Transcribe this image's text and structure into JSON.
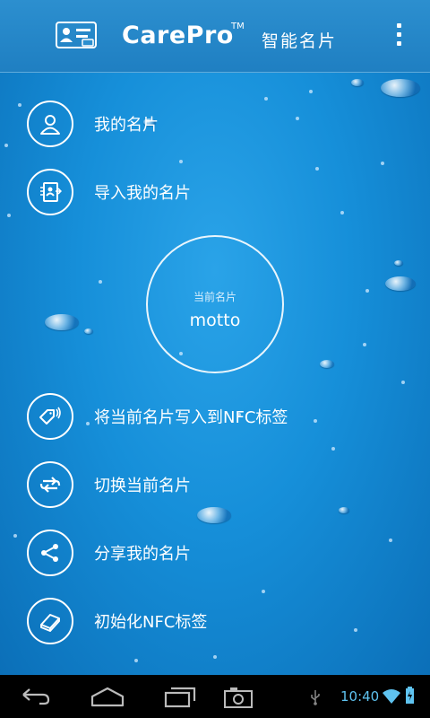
{
  "app": {
    "brand": "CarePro",
    "trademark": "TM",
    "title": "智能名片",
    "accent_color": "#1f7fc2"
  },
  "menu": {
    "items": [
      {
        "label": "我的名片",
        "icon": "person-icon"
      },
      {
        "label": "导入我的名片",
        "icon": "import-card-icon"
      },
      {
        "label": "将当前名片写入到NFC标签",
        "icon": "nfc-tag-icon"
      },
      {
        "label": "切换当前名片",
        "icon": "switch-icon"
      },
      {
        "label": "分享我的名片",
        "icon": "share-icon"
      },
      {
        "label": "初始化NFC标签",
        "icon": "eraser-icon"
      }
    ]
  },
  "current_card": {
    "caption": "当前名片",
    "name": "motto"
  },
  "status_bar": {
    "time": "10:40",
    "icons": [
      "usb-icon",
      "wifi-icon",
      "battery-icon"
    ]
  },
  "nav_bar": {
    "buttons": [
      "back-icon",
      "home-icon",
      "recent-apps-icon",
      "screenshot-icon"
    ]
  }
}
